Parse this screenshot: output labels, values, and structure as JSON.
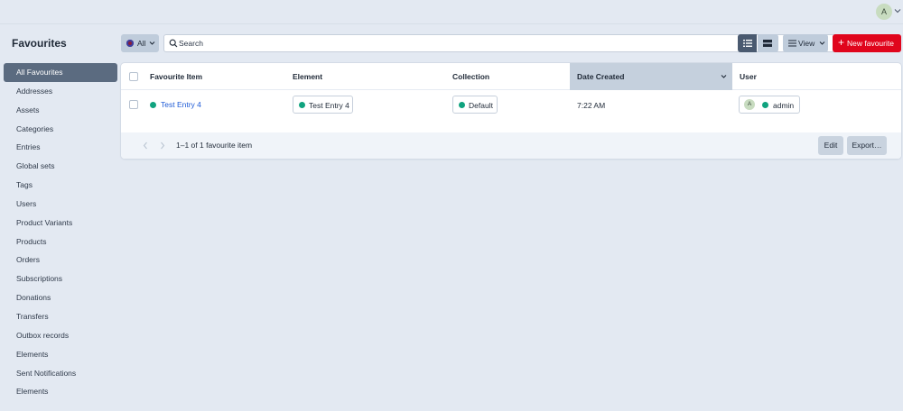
{
  "header": {
    "user_initial": "A"
  },
  "sidebar": {
    "title": "Favourites",
    "items": [
      {
        "label": "All Favourites"
      },
      {
        "label": "Addresses"
      },
      {
        "label": "Assets"
      },
      {
        "label": "Categories"
      },
      {
        "label": "Entries"
      },
      {
        "label": "Global sets"
      },
      {
        "label": "Tags"
      },
      {
        "label": "Users"
      },
      {
        "label": "Product Variants"
      },
      {
        "label": "Products"
      },
      {
        "label": "Orders"
      },
      {
        "label": "Subscriptions"
      },
      {
        "label": "Donations"
      },
      {
        "label": "Transfers"
      },
      {
        "label": "Outbox records"
      },
      {
        "label": "Elements"
      },
      {
        "label": "Sent Notifications"
      },
      {
        "label": "Elements"
      }
    ]
  },
  "toolbar": {
    "site_label": "All",
    "search_placeholder": "Search",
    "view_label": "View",
    "new_label": "New favourite"
  },
  "table": {
    "columns": {
      "item": "Favourite Item",
      "element": "Element",
      "collection": "Collection",
      "date": "Date Created",
      "user": "User"
    },
    "rows": [
      {
        "item": "Test Entry 4",
        "element": "Test Entry 4",
        "collection": "Default",
        "date": "7:22 AM",
        "user_initial": "A",
        "user": "admin"
      }
    ],
    "footer": {
      "range": "1–1 of 1 favourite item",
      "edit_label": "Edit",
      "export_label": "Export…"
    }
  },
  "colors": {
    "accent": "#e0051c",
    "status": "#10a37f",
    "link": "#1f5bd6",
    "sidebar_active": "#5b6b80"
  },
  "icons": [
    "chevron-down-icon",
    "search-icon",
    "filter-icon",
    "list-view-icon",
    "table-view-icon",
    "sliders-icon",
    "plus-icon",
    "chevron-left-icon",
    "chevron-right-icon"
  ]
}
